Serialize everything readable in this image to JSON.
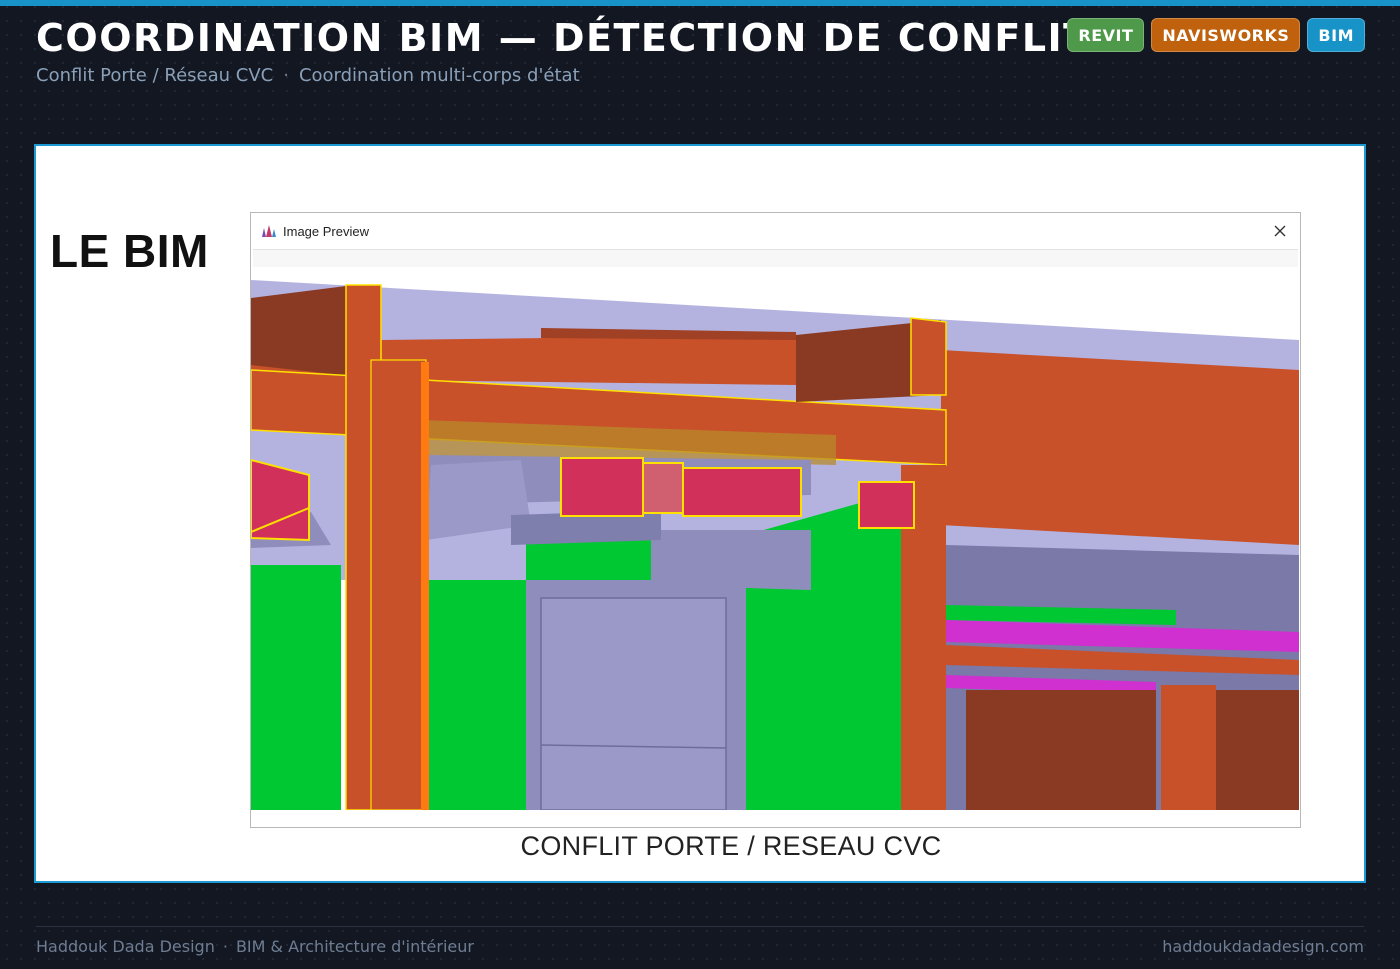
{
  "header": {
    "title": "COORDINATION BIM — DÉTECTION DE CONFLITS",
    "subtitle_main": "Conflit Porte / Réseau CVC",
    "subtitle_separator": "·",
    "subtitle_secondary": "Coordination multi-corps d'état",
    "badges": [
      {
        "label": "REVIT",
        "color": "#4e9a4a"
      },
      {
        "label": "NAVISWORKS",
        "color": "#c0620d"
      },
      {
        "label": "BIM",
        "color": "#1793c8"
      }
    ]
  },
  "slide": {
    "heading": "LE BIM",
    "window_title": "Image Preview",
    "window_icon": "navisworks-app-icon",
    "close_icon": "close-icon",
    "caption": "CONFLIT PORTE / RESEAU CVC",
    "colors": {
      "structure": "#c8512a",
      "ductwork": "#9a99c8",
      "walls": "#00c832",
      "clash_highlight": "#ffe000",
      "clash_fill": "#d0305a",
      "pipe": "#d030d0"
    }
  },
  "footer": {
    "company": "Haddouk Dada Design",
    "separator": "·",
    "tagline": "BIM & Architecture d'intérieur",
    "website": "haddoukdadadesign.com"
  }
}
